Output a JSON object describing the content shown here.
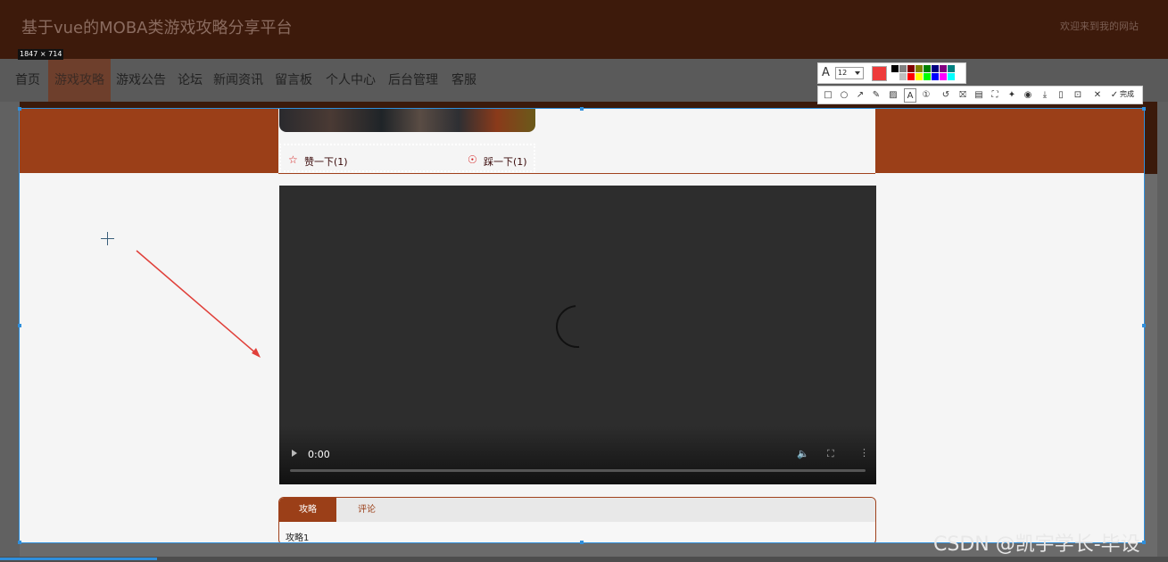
{
  "header": {
    "site_title": "基于vue的MOBA类游戏攻略分享平台",
    "welcome": "欢迎来到我的网站"
  },
  "nav": {
    "items": [
      {
        "label": "首页"
      },
      {
        "label": "游戏攻略",
        "active": true
      },
      {
        "label": "游戏公告"
      },
      {
        "label": "论坛"
      },
      {
        "label": "新闻资讯"
      },
      {
        "label": "留言板"
      },
      {
        "label": "个人中心"
      },
      {
        "label": "后台管理"
      },
      {
        "label": "客服"
      }
    ]
  },
  "screenshot_tool": {
    "size_badge": "1847 × 714",
    "font_size": "12",
    "current_color": "#ee3a3a",
    "done_label": "完成",
    "swatches_top": [
      "#000000",
      "#808080",
      "#800000",
      "#808000",
      "#008000",
      "#000080",
      "#800080",
      "#008080"
    ],
    "swatches_bottom": [
      "#ffffff",
      "#c0c0c0",
      "#ff0000",
      "#ffff00",
      "#00ff00",
      "#0000ff",
      "#ff00ff",
      "#00ffff"
    ],
    "tools": [
      "rectangle-icon",
      "ellipse-icon",
      "arrow-icon",
      "pen-icon",
      "mosaic-icon",
      "text-icon",
      "number-icon",
      "undo-icon",
      "save-icon",
      "ocr-icon",
      "scroll-capture-icon",
      "pin-icon",
      "record-icon",
      "download-icon",
      "copy-icon",
      "bookmark-icon",
      "close-icon"
    ]
  },
  "strategy": {
    "like_label": "赞一下(1)",
    "dislike_label": "踩一下(1)"
  },
  "video": {
    "time": "0:00"
  },
  "tabs": {
    "guide_tab": "攻略",
    "comment_tab": "评论",
    "content": "攻略1"
  },
  "watermark": "CSDN @凯宇学长-毕设"
}
